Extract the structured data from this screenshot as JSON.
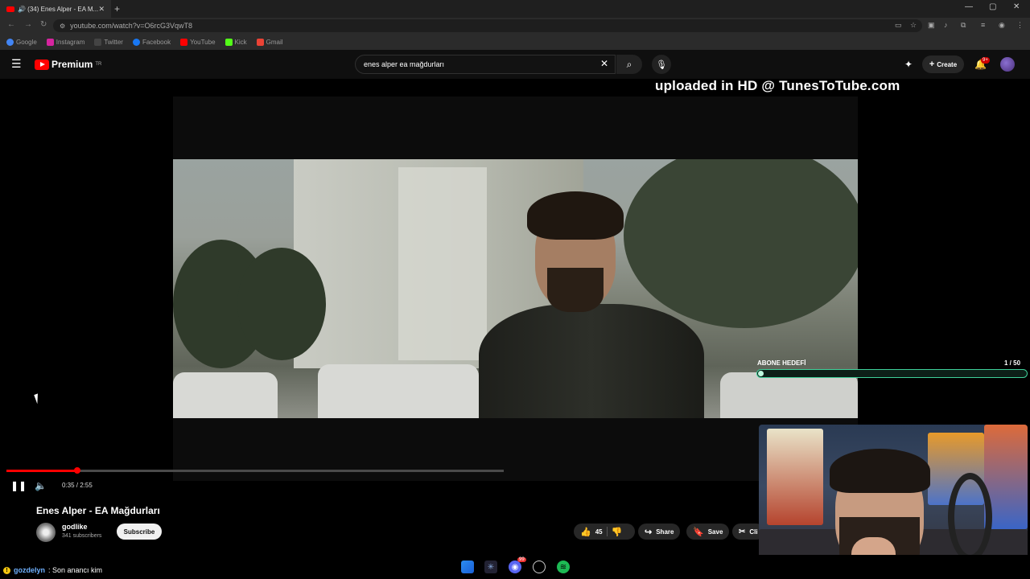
{
  "browser": {
    "tab_title": "🔊 (34) Enes Alper - EA M...",
    "tab_close": "✕",
    "new_tab": "+",
    "url": "youtube.com/watch?v=O6rcG3VqwT8",
    "window_controls": [
      "—",
      "▢",
      "✕"
    ],
    "bookmarks": [
      {
        "label": "Google",
        "color": "#4285f4"
      },
      {
        "label": "Instagram",
        "color": "#d6249f"
      },
      {
        "label": "Twitter",
        "color": "#444444"
      },
      {
        "label": "Facebook",
        "color": "#1877f2"
      },
      {
        "label": "YouTube",
        "color": "#ff0000"
      },
      {
        "label": "Kick",
        "color": "#53fc18"
      },
      {
        "label": "Gmail",
        "color": "#ea4335"
      }
    ]
  },
  "youtube": {
    "logo_text": "Premium",
    "logo_region": "TR",
    "search_value": "enes alper ea mağdurları",
    "create_label": "Create",
    "notif_badge": "9+"
  },
  "overlay": {
    "uploaded_text": "uploaded in HD @ TunesToTube.com",
    "goal_label": "ABONE HEDEFİ",
    "goal_count": "1 / 50",
    "goal_progress": 0.02
  },
  "player": {
    "time": "0:35 / 2:55",
    "progress": 0.07,
    "buffered": 0.48
  },
  "video": {
    "title": "Enes Alper - EA Mağdurları",
    "channel": "godlike",
    "subscribers": "341 subscribers",
    "subscribe_label": "Subscribe",
    "likes": "45",
    "share_label": "Share",
    "save_label": "Save",
    "clip_label": "Cli"
  },
  "chat": {
    "user": "gozdelyn",
    "message": ": Son anancı kim",
    "badge": "!"
  },
  "taskbar": {
    "discord_badge": "99"
  }
}
